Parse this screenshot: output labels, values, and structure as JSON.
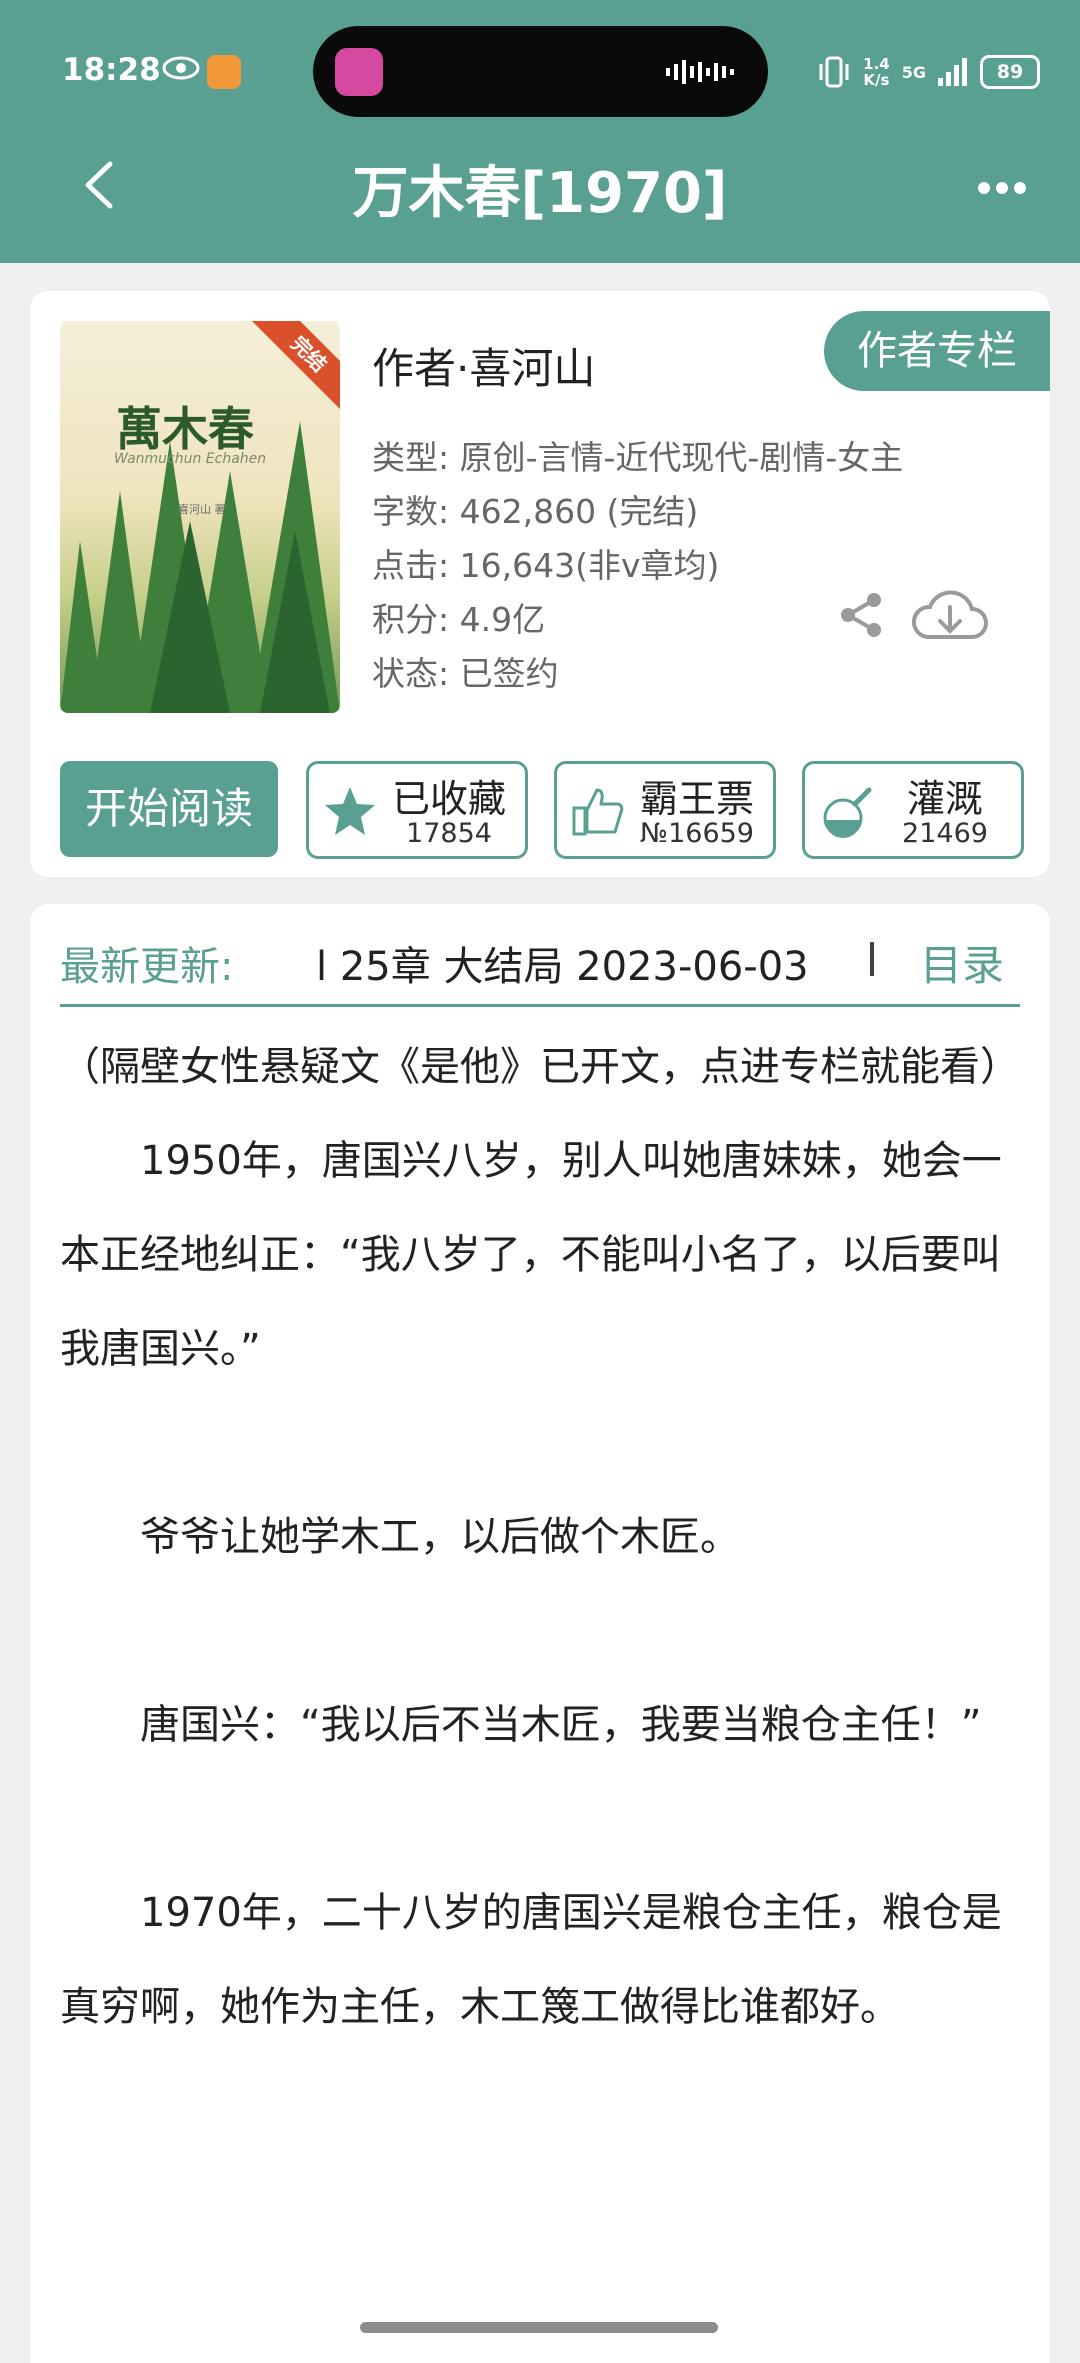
{
  "status_bar": {
    "time": "18:28",
    "speed_value": "1.4",
    "speed_unit": "K/s",
    "network": "5G",
    "battery": "89"
  },
  "header": {
    "title": "万木春[1970]",
    "back_icon": "chevron-left-icon",
    "more_icon": "more-horizontal-icon"
  },
  "book": {
    "cover_title": "萬木春",
    "cover_subtitle": "Wanmuchun  Echahen",
    "cover_author": "喜河山 著",
    "cover_badge": "完结",
    "author": "作者·喜河山",
    "author_column_button": "作者专栏",
    "meta": {
      "type": "类型: 原创-言情-近代现代-剧情-女主",
      "words": "字数: 462,860 (完结)",
      "clicks": "点击: 16,643(非v章均)",
      "score": "积分: 4.9亿",
      "status": "状态: 已签约"
    }
  },
  "actions": {
    "start_reading": "开始阅读",
    "favorite": {
      "label": "已收藏",
      "count": "17854"
    },
    "ticket": {
      "label": "霸王票",
      "count": "№16659"
    },
    "nutrient": {
      "label": "灌溉",
      "count": "21469"
    }
  },
  "latest": {
    "label": "最新更新:",
    "text": "l 25章  大结局  2023-06-03",
    "toc": "目录"
  },
  "story": [
    "（隔壁女性悬疑文《是他》已开文，点进专栏就能看）",
    "　　1950年，唐国兴八岁，别人叫她唐妹妹，她会一本正经地纠正：“我八岁了，不能叫小名了，以后要叫我唐国兴。”",
    "",
    "　　爷爷让她学木工，以后做个木匠。",
    "",
    "　　唐国兴：“我以后不当木匠，我要当粮仓主任！”",
    "",
    "　　1970年，二十八岁的唐国兴是粮仓主任，粮仓是真穷啊，她作为主任，木工篾工做得比谁都好。"
  ],
  "colors": {
    "accent": "#599f92",
    "background": "#efefef"
  }
}
